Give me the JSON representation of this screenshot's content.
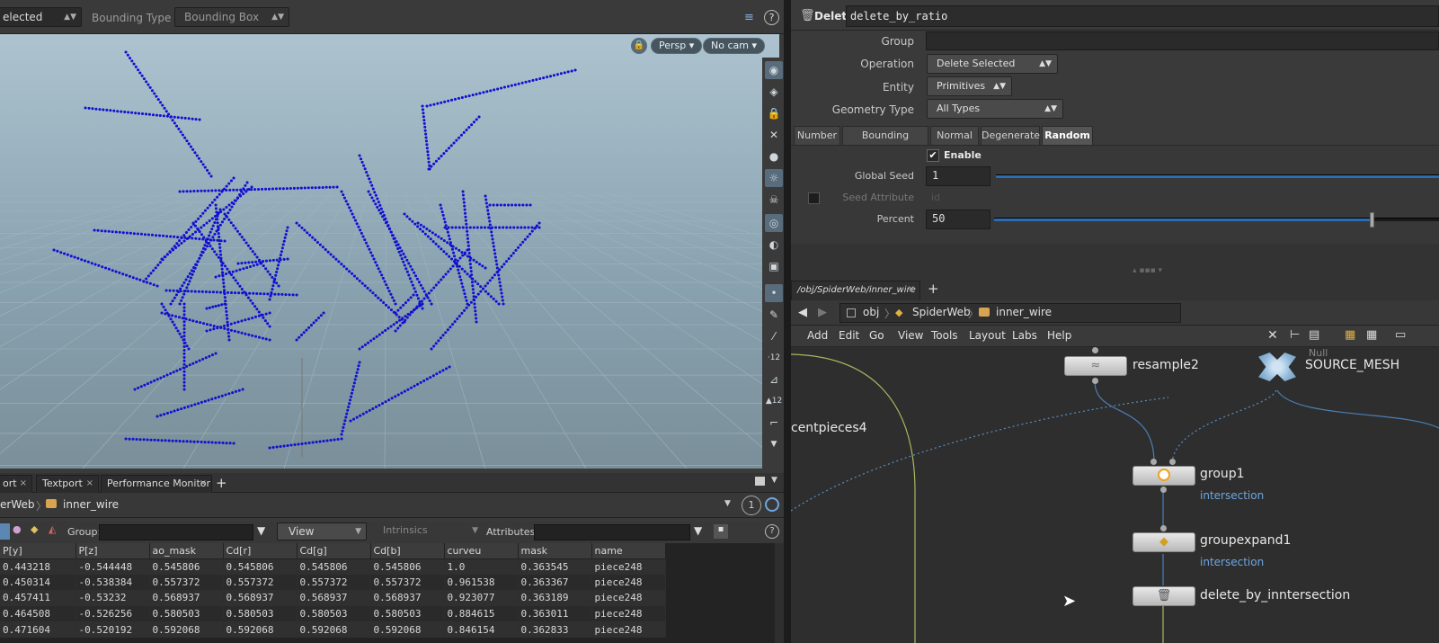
{
  "viewport_toolbar": {
    "selection_mode": "elected",
    "bounding_type_label": "Bounding Type",
    "bounding_type_value": "Bounding Box"
  },
  "viewport": {
    "camera_view": "Persp",
    "camera": "No cam"
  },
  "bottom_tabs": [
    {
      "label": "ort"
    },
    {
      "label": "Textport"
    },
    {
      "label": "Performance Monitor"
    }
  ],
  "bottom_path": {
    "parent": "erWeb",
    "current": "inner_wire"
  },
  "spreadsheet": {
    "group_label": "Group:",
    "view_label": "View",
    "intrinsics_label": "Intrinsics",
    "attributes_label": "Attributes:",
    "columns": [
      "P[y]",
      "P[z]",
      "ao_mask",
      "Cd[r]",
      "Cd[g]",
      "Cd[b]",
      "curveu",
      "mask",
      "name"
    ],
    "rows": [
      [
        "0.443218",
        "-0.544448",
        "0.545806",
        "0.545806",
        "0.545806",
        "0.545806",
        "1.0",
        "0.363545",
        "piece248"
      ],
      [
        "0.450314",
        "-0.538384",
        "0.557372",
        "0.557372",
        "0.557372",
        "0.557372",
        "0.961538",
        "0.363367",
        "piece248"
      ],
      [
        "0.457411",
        "-0.53232",
        "0.568937",
        "0.568937",
        "0.568937",
        "0.568937",
        "0.923077",
        "0.363189",
        "piece248"
      ],
      [
        "0.464508",
        "-0.526256",
        "0.580503",
        "0.580503",
        "0.580503",
        "0.580503",
        "0.884615",
        "0.363011",
        "piece248"
      ],
      [
        "0.471604",
        "-0.520192",
        "0.592068",
        "0.592068",
        "0.592068",
        "0.592068",
        "0.846154",
        "0.362833",
        "piece248"
      ]
    ]
  },
  "params": {
    "node_type": "Delete",
    "node_name": "delete_by_ratio",
    "group_label": "Group",
    "group_value": "",
    "operation_label": "Operation",
    "operation_value": "Delete Selected",
    "entity_label": "Entity",
    "entity_value": "Primitives",
    "geometry_type_label": "Geometry Type",
    "geometry_type_value": "All Types",
    "tabs": [
      "Number",
      "Bounding Volume",
      "Normal",
      "Degenerate",
      "Random"
    ],
    "selected_tab": "Random",
    "enable_label": "Enable",
    "enable_checked": true,
    "global_seed_label": "Global Seed",
    "global_seed_value": "1",
    "seed_attribute_label": "Seed Attribute",
    "seed_attribute_value": "id",
    "percent_label": "Percent",
    "percent_value": "50",
    "percent_fraction": 0.5
  },
  "network": {
    "tab_label": "/obj/SpiderWeb/inner_wire",
    "path": [
      "obj",
      "SpiderWeb",
      "inner_wire"
    ],
    "menu": [
      "Add",
      "Edit",
      "Go",
      "View",
      "Tools",
      "Layout",
      "Labs",
      "Help"
    ],
    "nodes": [
      {
        "name": "resample2",
        "subtitle": ""
      },
      {
        "name": "SOURCE_MESH",
        "subtitle": "Null"
      },
      {
        "name": "centpieces4",
        "subtitle": ""
      },
      {
        "name": "group1",
        "subtitle": "intersection"
      },
      {
        "name": "groupexpand1",
        "subtitle": "intersection"
      },
      {
        "name": "delete_by_inntersection",
        "subtitle": ""
      }
    ]
  },
  "colors": {
    "accent": "#6fa6e0",
    "points": "#1010d0"
  }
}
